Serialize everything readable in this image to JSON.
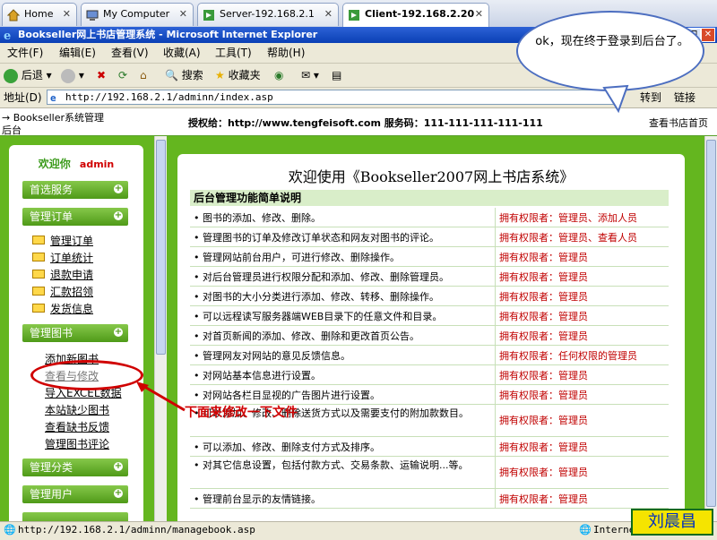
{
  "vm_tabs": [
    {
      "label": "Home",
      "icon": "home-icon"
    },
    {
      "label": "My Computer",
      "icon": "computer-icon"
    },
    {
      "label": "Server-192.168.2.1",
      "icon": "vm-icon"
    },
    {
      "label": "Client-192.168.2.20",
      "icon": "vm-icon",
      "active": true
    }
  ],
  "window": {
    "title": "Bookseller网上书店管理系统 - Microsoft Internet Explorer"
  },
  "menu": [
    "文件(F)",
    "编辑(E)",
    "查看(V)",
    "收藏(A)",
    "工具(T)",
    "帮助(H)"
  ],
  "toolbar": {
    "back": "后退",
    "search": "搜索",
    "favorites": "收藏夹"
  },
  "address": {
    "label": "地址(D)",
    "url": "http://192.168.2.1/adminn/index.asp",
    "go": "转到",
    "links": "链接"
  },
  "page_header": {
    "breadcrumb": "→ Bookseller系统管理",
    "sub": "后台",
    "license": "授权给：http://www.tengfeisoft.com 服务码：111-111-111-111-111",
    "view_home": "查看书店首页"
  },
  "sidebar": {
    "welcome": "欢迎你",
    "user": "admin",
    "sections": [
      "首选服务",
      "管理订单",
      "管理图书",
      "管理分类",
      "管理用户"
    ],
    "order_links": [
      "管理订单",
      "订单统计",
      "退款申请",
      "汇款招领",
      "发货信息"
    ],
    "book_links": [
      "添加新图书",
      "查看与修改",
      "导入EXCEL数据",
      "本站缺少图书",
      "查看缺书反馈",
      "管理图书评论"
    ]
  },
  "main": {
    "welcome": "欢迎使用《Bookseller2007网上书店系统》",
    "table_title": "后台管理功能简单说明",
    "rows": [
      {
        "desc": "• 图书的添加、修改、删除。",
        "perm": "拥有权限者：管理员、添加人员"
      },
      {
        "desc": "• 管理图书的订单及修改订单状态和网友对图书的评论。",
        "perm": "拥有权限者：管理员、查看人员"
      },
      {
        "desc": "• 管理网站前台用户，可进行修改、删除操作。",
        "perm": "拥有权限者：管理员"
      },
      {
        "desc": "• 对后台管理员进行权限分配和添加、修改、删除管理员。",
        "perm": "拥有权限者：管理员"
      },
      {
        "desc": "• 对图书的大小分类进行添加、修改、转移、删除操作。",
        "perm": "拥有权限者：管理员"
      },
      {
        "desc": "• 可以远程读写服务器端WEB目录下的任意文件和目录。",
        "perm": "拥有权限者：管理员"
      },
      {
        "desc": "• 对首页新闻的添加、修改、删除和更改首页公告。",
        "perm": "拥有权限者：管理员"
      },
      {
        "desc": "• 管理网友对网站的意见反馈信息。",
        "perm": "拥有权限者：任何权限的管理员"
      },
      {
        "desc": "• 对网站基本信息进行设置。",
        "perm": "拥有权限者：管理员"
      },
      {
        "desc": "• 对网站各栏目显视的广告图片进行设置。",
        "perm": "拥有权限者：管理员"
      },
      {
        "desc": "• 可以添加、修改、删除送货方式以及需要支付的附加款数目。",
        "perm": "拥有权限者：管理员"
      },
      {
        "desc": "• 可以添加、修改、删除支付方式及排序。",
        "perm": "拥有权限者：管理员"
      },
      {
        "desc": "• 对其它信息设置，包括付款方式、交易条款、运输说明...等。",
        "perm": "拥有权限者：管理员"
      },
      {
        "desc": "• 管理前台显示的友情链接。",
        "perm": "拥有权限者：管理员"
      }
    ]
  },
  "statusbar": {
    "url": "http://192.168.2.1/adminn/managebook.asp",
    "zone": "Interne"
  },
  "annotations": {
    "callout": "ok，现在终于登录到后台了。",
    "arrow_note": "下面来修改一下文件",
    "author": "刘晨昌"
  },
  "colors": {
    "panel_green": "#64b61f",
    "perm_red": "#c00000",
    "annot_red": "#d00000"
  }
}
